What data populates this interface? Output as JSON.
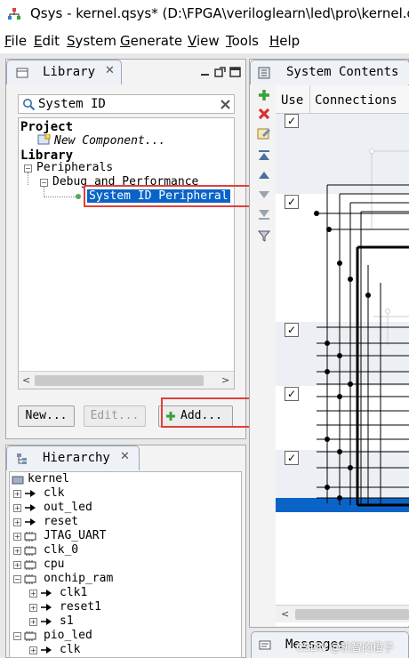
{
  "window": {
    "title": "Qsys - kernel.qsys* (D:\\FPGA\\veriloglearn\\led\\pro\\kernel.q"
  },
  "menu": [
    {
      "label": "File",
      "mnemonic": "F"
    },
    {
      "label": "Edit",
      "mnemonic": "E"
    },
    {
      "label": "System",
      "mnemonic": "S"
    },
    {
      "label": "Generate",
      "mnemonic": "G"
    },
    {
      "label": "View",
      "mnemonic": "V"
    },
    {
      "label": "Tools",
      "mnemonic": "T"
    },
    {
      "label": "Help",
      "mnemonic": "H"
    }
  ],
  "library": {
    "tab_label": "Library",
    "search_value": "System ID",
    "tree": {
      "project_heading": "Project",
      "new_component": "New Component...",
      "library_heading": "Library",
      "peripherals": "Peripherals",
      "debug_perf": "Debug and Performance",
      "selected_item": "System ID Peripheral"
    },
    "buttons": {
      "new": "New...",
      "edit": "Edit...",
      "add": "Add..."
    }
  },
  "system_contents": {
    "tab_label": "System Contents",
    "columns": {
      "use": "Use",
      "connections": "Connections"
    }
  },
  "hierarchy": {
    "tab_label": "Hierarchy",
    "root": "kernel",
    "items": [
      {
        "label": "clk",
        "depth": 1,
        "icon": "port-icon"
      },
      {
        "label": "out_led",
        "depth": 1,
        "icon": "port-icon"
      },
      {
        "label": "reset",
        "depth": 1,
        "icon": "port-icon"
      },
      {
        "label": "JTAG_UART",
        "depth": 1,
        "icon": "module-icon"
      },
      {
        "label": "clk_0",
        "depth": 1,
        "icon": "module-icon"
      },
      {
        "label": "cpu",
        "depth": 1,
        "icon": "module-icon"
      },
      {
        "label": "onchip_ram",
        "depth": 1,
        "icon": "module-icon"
      },
      {
        "label": "clk1",
        "depth": 2,
        "icon": "port-icon"
      },
      {
        "label": "reset1",
        "depth": 2,
        "icon": "port-icon"
      },
      {
        "label": "s1",
        "depth": 2,
        "icon": "port-icon"
      },
      {
        "label": "pio_led",
        "depth": 1,
        "icon": "module-icon"
      },
      {
        "label": "clk",
        "depth": 2,
        "icon": "port-icon"
      }
    ]
  },
  "messages": {
    "tab_label": "Messages"
  },
  "watermark": "CSDN @机智的橙子",
  "colors": {
    "selection": "#0a64c8",
    "highlight_box": "#e0403a",
    "add_icon": "#3aa03a",
    "remove_icon": "#d93030"
  }
}
